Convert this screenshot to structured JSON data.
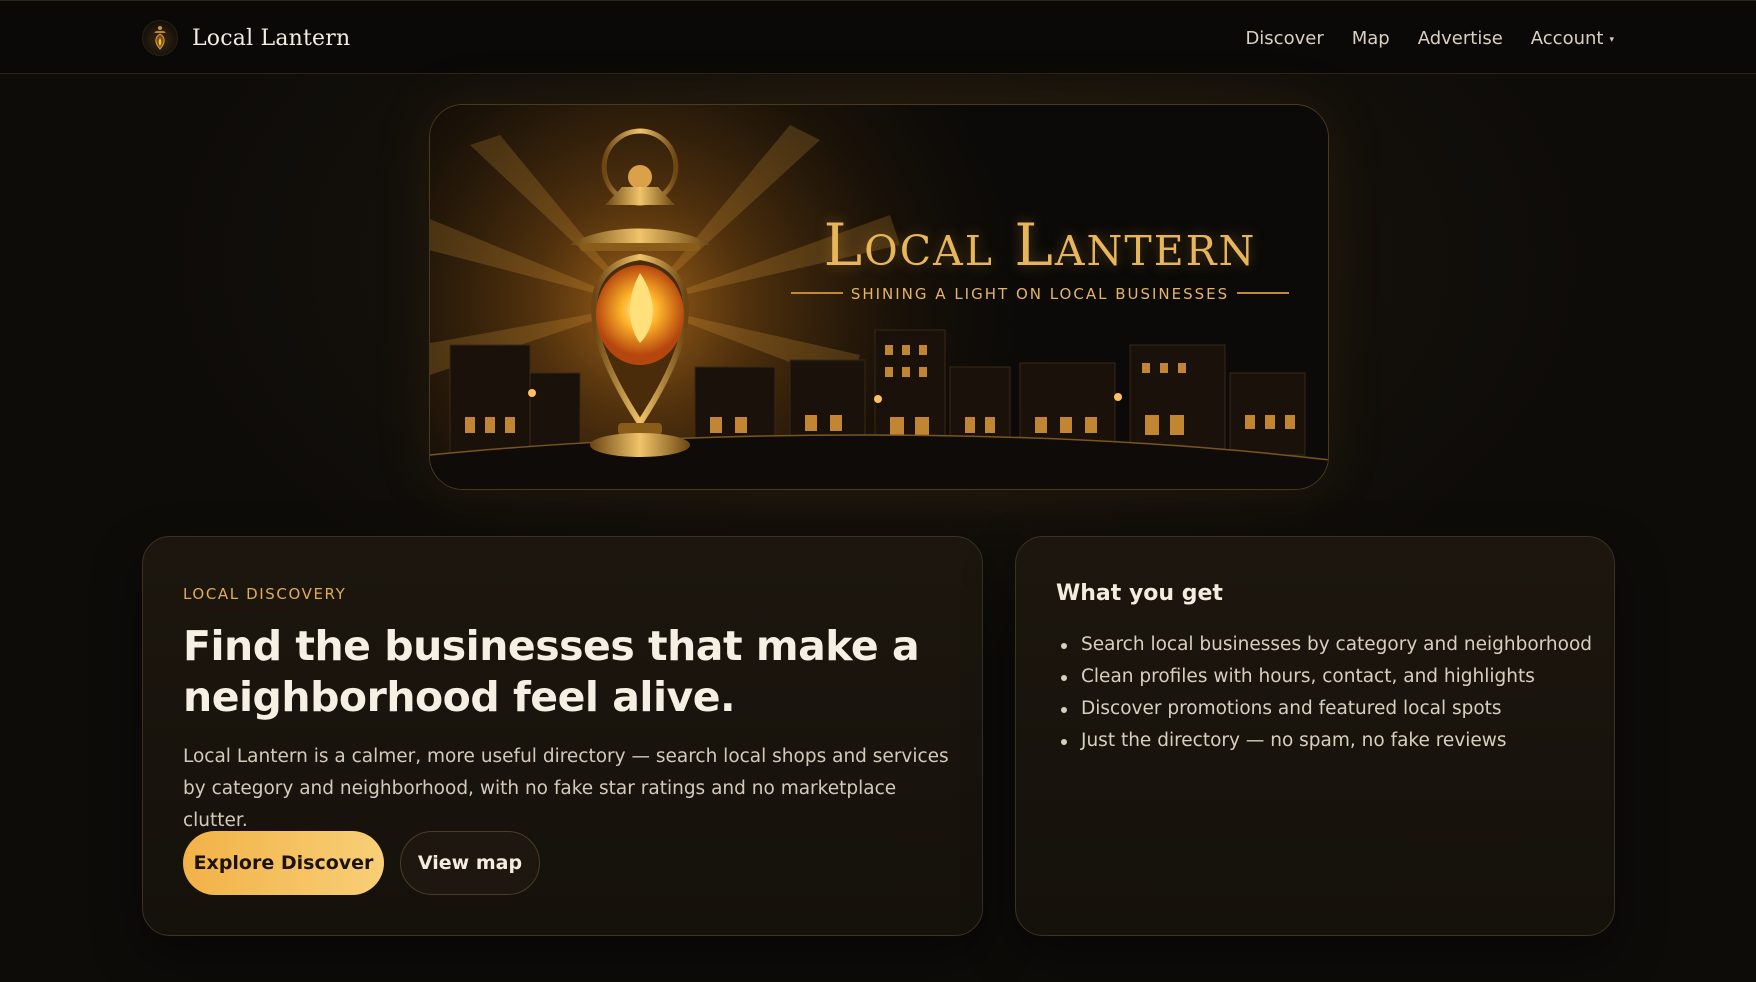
{
  "nav": {
    "brand_name": "Local Lantern",
    "links": [
      "Discover",
      "Map",
      "Advertise",
      "Account"
    ],
    "account_caret": "▾"
  },
  "banner": {
    "title": "Local Lantern",
    "subtitle": "SHINING A LIGHT ON LOCAL BUSINESSES"
  },
  "hero": {
    "eyebrow": "LOCAL DISCOVERY",
    "headline": "Find the businesses that make a neighborhood feel alive.",
    "description": "Local Lantern is a calmer, more useful directory — search local shops and services by category and neighborhood, with no fake star ratings and no marketplace clutter.",
    "primary_button": "Explore Discover",
    "secondary_button": "View map"
  },
  "features": {
    "title": "What you get",
    "items": [
      "Search local businesses by category and neighborhood",
      "Clean profiles with hours, contact, and highlights",
      "Discover promotions and featured local spots",
      "Just the directory — no spam, no fake reviews"
    ]
  },
  "colors": {
    "accent": "#f2b247",
    "background": "#0d0b08",
    "card": "#1a140d"
  }
}
